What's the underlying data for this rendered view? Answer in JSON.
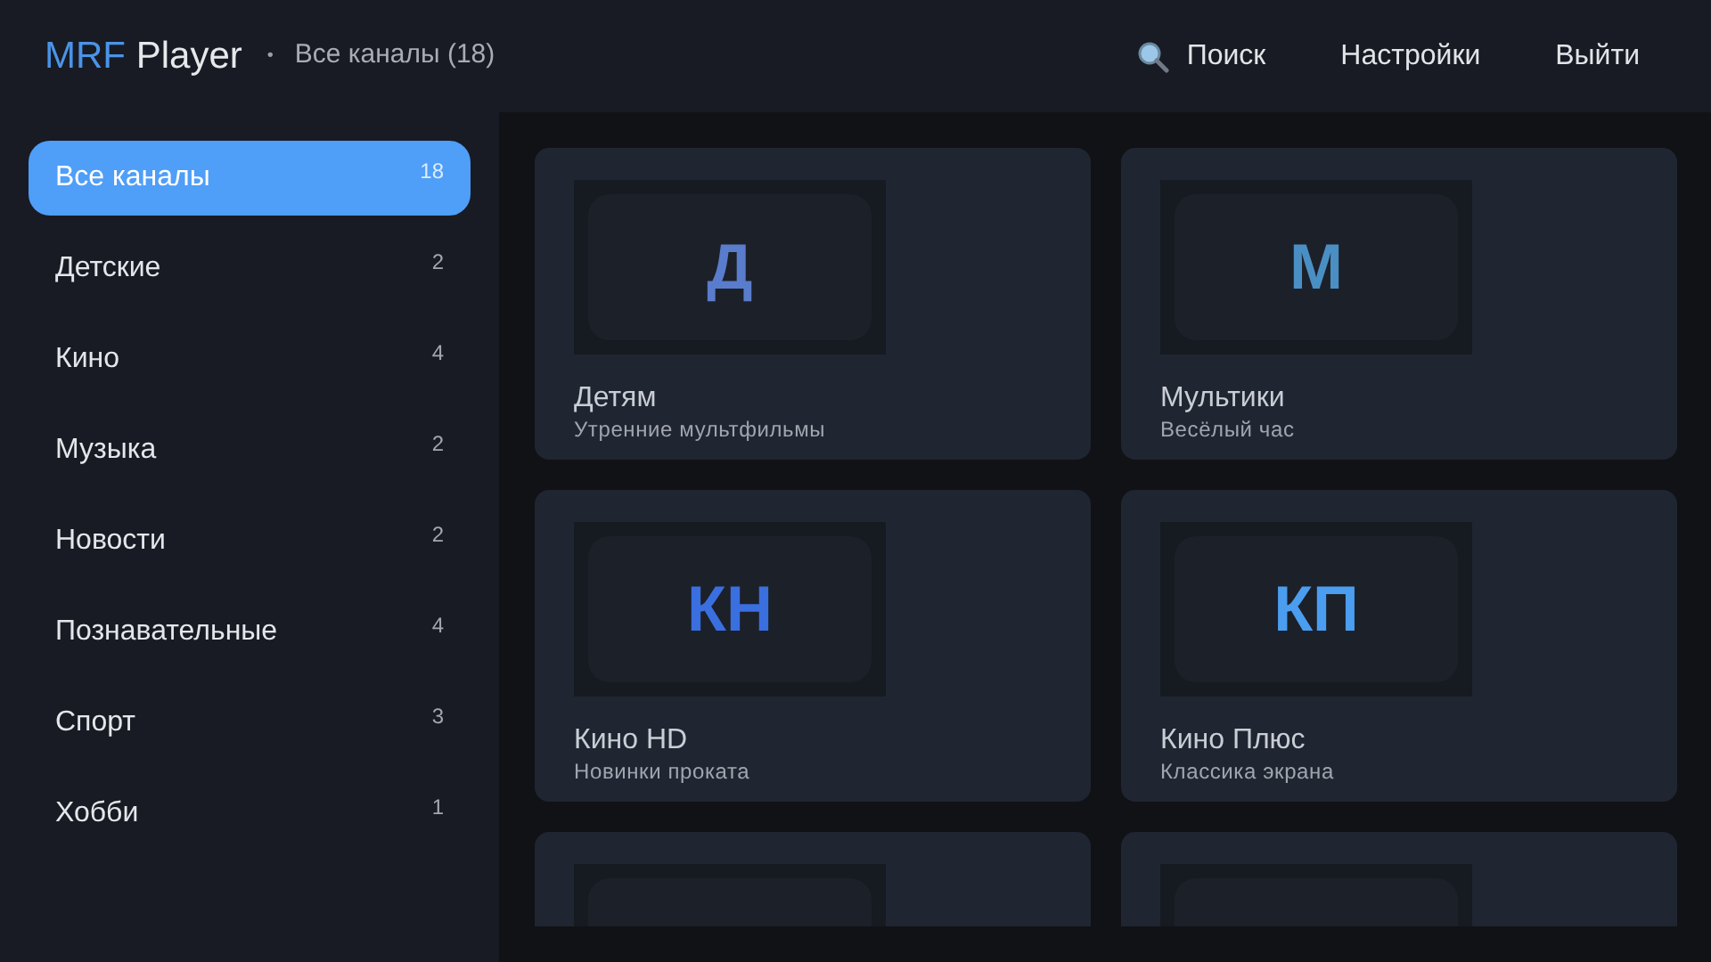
{
  "header": {
    "brand_accent": "MRF",
    "brand_rest": "Player",
    "separator": "•",
    "subtitle": "Все каналы (18)",
    "actions": [
      {
        "kind": "search",
        "label": "Поиск"
      },
      {
        "kind": "text",
        "label": "Настройки"
      },
      {
        "kind": "text",
        "label": "Выйти"
      }
    ]
  },
  "sidebar": {
    "items": [
      {
        "label": "Все каналы",
        "count": "18",
        "selected": true
      },
      {
        "label": "Детские",
        "count": "2",
        "selected": false
      },
      {
        "label": "Кино",
        "count": "4",
        "selected": false
      },
      {
        "label": "Музыка",
        "count": "2",
        "selected": false
      },
      {
        "label": "Новости",
        "count": "2",
        "selected": false
      },
      {
        "label": "Познавательные",
        "count": "4",
        "selected": false
      },
      {
        "label": "Спорт",
        "count": "3",
        "selected": false
      },
      {
        "label": "Хобби",
        "count": "1",
        "selected": false
      }
    ]
  },
  "channels": [
    {
      "logo": "Д",
      "color": "#5a7ccc",
      "name": "Детям",
      "program": "Утренние мультфильмы"
    },
    {
      "logo": "М",
      "color": "#4a8fc4",
      "name": "Мультики",
      "program": "Весёлый час"
    },
    {
      "logo": "КН",
      "color": "#3a6fe0",
      "name": "Кино HD",
      "program": "Новинки проката"
    },
    {
      "logo": "КП",
      "color": "#4b9df0",
      "name": "Кино Плюс",
      "program": "Классика экрана"
    }
  ],
  "more_cards_below": true
}
